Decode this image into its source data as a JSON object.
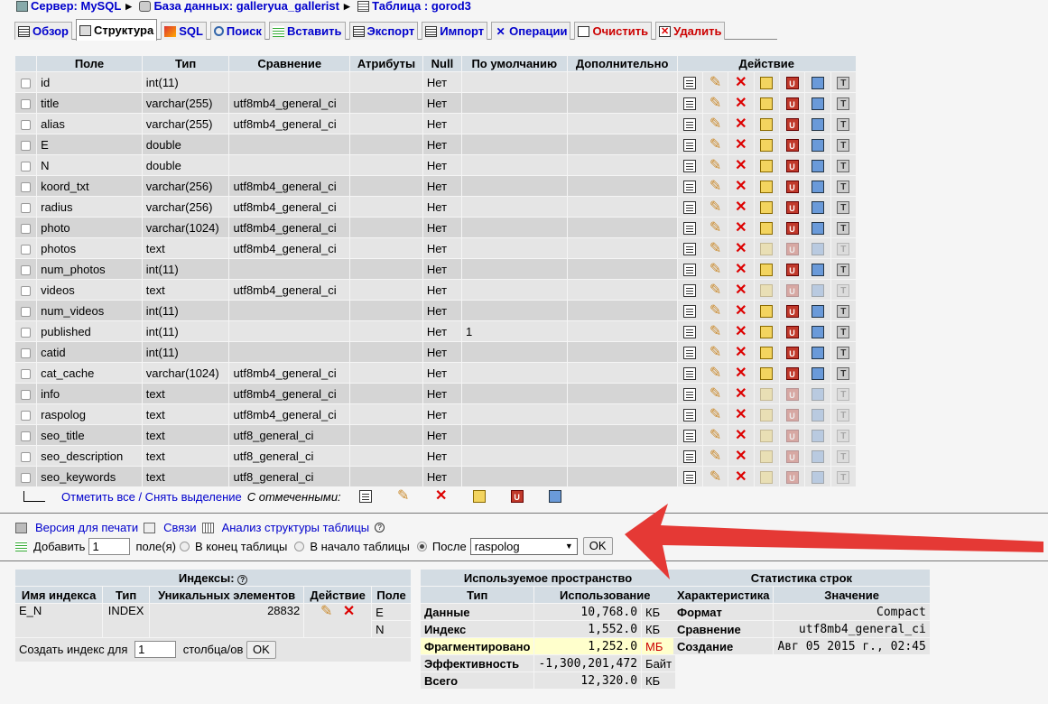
{
  "breadcrumb": {
    "server": "Сервер: MySQL",
    "database": "База данных: galleryua_gallerist",
    "table": "Таблица : gorod3"
  },
  "tabs": [
    {
      "label": "Обзор"
    },
    {
      "label": "Структура"
    },
    {
      "label": "SQL"
    },
    {
      "label": "Поиск"
    },
    {
      "label": "Вставить"
    },
    {
      "label": "Экспорт"
    },
    {
      "label": "Импорт"
    },
    {
      "label": "Операции"
    },
    {
      "label": "Очистить"
    },
    {
      "label": "Удалить"
    }
  ],
  "structure": {
    "headers": [
      "Поле",
      "Тип",
      "Сравнение",
      "Атрибуты",
      "Null",
      "По умолчанию",
      "Дополнительно",
      "Действие"
    ],
    "rows": [
      {
        "field": "id",
        "type": "int(11)",
        "collation": "",
        "attributes": "",
        "null": "Нет",
        "default": "",
        "extra": ""
      },
      {
        "field": "title",
        "type": "varchar(255)",
        "collation": "utf8mb4_general_ci",
        "attributes": "",
        "null": "Нет",
        "default": "",
        "extra": ""
      },
      {
        "field": "alias",
        "type": "varchar(255)",
        "collation": "utf8mb4_general_ci",
        "attributes": "",
        "null": "Нет",
        "default": "",
        "extra": ""
      },
      {
        "field": "E",
        "type": "double",
        "collation": "",
        "attributes": "",
        "null": "Нет",
        "default": "",
        "extra": ""
      },
      {
        "field": "N",
        "type": "double",
        "collation": "",
        "attributes": "",
        "null": "Нет",
        "default": "",
        "extra": ""
      },
      {
        "field": "koord_txt",
        "type": "varchar(256)",
        "collation": "utf8mb4_general_ci",
        "attributes": "",
        "null": "Нет",
        "default": "",
        "extra": ""
      },
      {
        "field": "radius",
        "type": "varchar(256)",
        "collation": "utf8mb4_general_ci",
        "attributes": "",
        "null": "Нет",
        "default": "",
        "extra": ""
      },
      {
        "field": "photo",
        "type": "varchar(1024)",
        "collation": "utf8mb4_general_ci",
        "attributes": "",
        "null": "Нет",
        "default": "",
        "extra": ""
      },
      {
        "field": "photos",
        "type": "text",
        "collation": "utf8mb4_general_ci",
        "attributes": "",
        "null": "Нет",
        "default": "",
        "extra": ""
      },
      {
        "field": "num_photos",
        "type": "int(11)",
        "collation": "",
        "attributes": "",
        "null": "Нет",
        "default": "",
        "extra": ""
      },
      {
        "field": "videos",
        "type": "text",
        "collation": "utf8mb4_general_ci",
        "attributes": "",
        "null": "Нет",
        "default": "",
        "extra": ""
      },
      {
        "field": "num_videos",
        "type": "int(11)",
        "collation": "",
        "attributes": "",
        "null": "Нет",
        "default": "",
        "extra": ""
      },
      {
        "field": "published",
        "type": "int(11)",
        "collation": "",
        "attributes": "",
        "null": "Нет",
        "default": "1",
        "extra": ""
      },
      {
        "field": "catid",
        "type": "int(11)",
        "collation": "",
        "attributes": "",
        "null": "Нет",
        "default": "",
        "extra": ""
      },
      {
        "field": "cat_cache",
        "type": "varchar(1024)",
        "collation": "utf8mb4_general_ci",
        "attributes": "",
        "null": "Нет",
        "default": "",
        "extra": ""
      },
      {
        "field": "info",
        "type": "text",
        "collation": "utf8mb4_general_ci",
        "attributes": "",
        "null": "Нет",
        "default": "",
        "extra": ""
      },
      {
        "field": "raspolog",
        "type": "text",
        "collation": "utf8mb4_general_ci",
        "attributes": "",
        "null": "Нет",
        "default": "",
        "extra": ""
      },
      {
        "field": "seo_title",
        "type": "text",
        "collation": "utf8_general_ci",
        "attributes": "",
        "null": "Нет",
        "default": "",
        "extra": ""
      },
      {
        "field": "seo_description",
        "type": "text",
        "collation": "utf8_general_ci",
        "attributes": "",
        "null": "Нет",
        "default": "",
        "extra": ""
      },
      {
        "field": "seo_keywords",
        "type": "text",
        "collation": "utf8_general_ci",
        "attributes": "",
        "null": "Нет",
        "default": "",
        "extra": ""
      }
    ]
  },
  "select_bar": {
    "check_all": "Отметить все / Снять выделение",
    "with_selected": "С отмеченными:"
  },
  "links": {
    "print": "Версия для печати",
    "relations": "Связи",
    "analyze": "Анализ структуры таблицы"
  },
  "add_field": {
    "add_label": "Добавить",
    "count": "1",
    "fields_label": "поле(я)",
    "end": "В конец таблицы",
    "begin": "В начало таблицы",
    "after": "После",
    "after_value": "raspolog",
    "ok": "OK"
  },
  "indexes": {
    "title": "Индексы:",
    "headers": [
      "Имя индекса",
      "Тип",
      "Уникальных элементов",
      "Действие",
      "Поле"
    ],
    "name": "E_N",
    "type": "INDEX",
    "cardinality": "28832",
    "fields": [
      "E",
      "N"
    ],
    "create_label": "Создать индекс для",
    "create_count": "1",
    "columns_label": "столбца/ов",
    "ok": "OK"
  },
  "space": {
    "title": "Используемое пространство",
    "headers": [
      "Тип",
      "Использование"
    ],
    "rows": [
      {
        "type": "Данные",
        "value": "10,768.0",
        "unit": "КБ"
      },
      {
        "type": "Индекс",
        "value": "1,552.0",
        "unit": "КБ"
      },
      {
        "type": "Фрагментировано",
        "value": "1,252.0",
        "unit": "МБ"
      },
      {
        "type": "Эффективность",
        "value": "-1,300,201,472",
        "unit": "Байт"
      },
      {
        "type": "Всего",
        "value": "12,320.0",
        "unit": "КБ"
      }
    ]
  },
  "rowstats": {
    "title": "Статистика строк",
    "headers": [
      "Характеристика",
      "Значение"
    ],
    "rows": [
      {
        "key": "Формат",
        "value": "Compact"
      },
      {
        "key": "Сравнение",
        "value": "utf8mb4_general_ci"
      },
      {
        "key": "Создание",
        "value": "Авг 05 2015 г., 02:45"
      }
    ]
  },
  "colors": {
    "header": "#d3dce3",
    "row": "#e5e5e5",
    "arrow": "#e53935",
    "link": "#0000cc"
  }
}
